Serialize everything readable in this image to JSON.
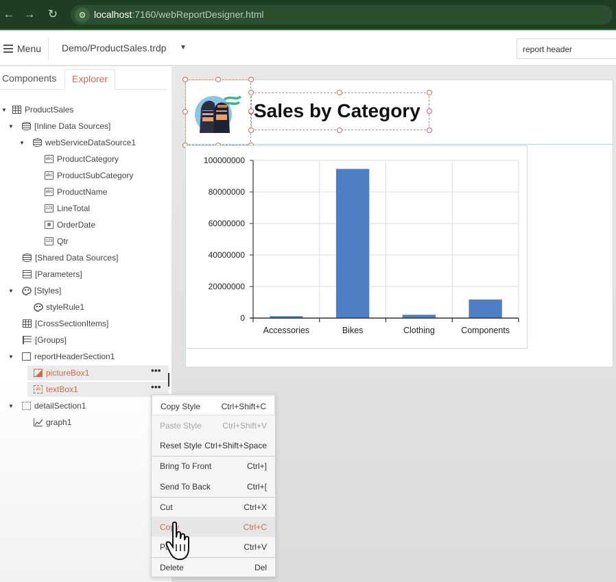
{
  "browser": {
    "url_host": "localhost",
    "url_rest": ":7160/webReportDesigner.html"
  },
  "toolbar": {
    "menu_label": "Menu",
    "document": "Demo/ProductSales.trdp",
    "search_value": "report header"
  },
  "tabs": {
    "components": "Components",
    "explorer": "Explorer"
  },
  "tree": [
    {
      "label": "ProductSales",
      "icon": "table-icon"
    },
    {
      "label": "[Inline Data Sources]",
      "icon": "database-icon"
    },
    {
      "label": "webServiceDataSource1",
      "icon": "web-database-icon"
    },
    {
      "label": "ProductCategory",
      "icon": "text-field-icon",
      "badge": "abc"
    },
    {
      "label": "ProductSubCategory",
      "icon": "text-field-icon",
      "badge": "abc"
    },
    {
      "label": "ProductName",
      "icon": "text-field-icon",
      "badge": "abc"
    },
    {
      "label": "LineTotal",
      "icon": "number-field-icon",
      "badge": "123"
    },
    {
      "label": "OrderDate",
      "icon": "date-field-icon",
      "badge": ""
    },
    {
      "label": "Qtr",
      "icon": "number-field-icon",
      "badge": "123"
    },
    {
      "label": "[Shared Data Sources]",
      "icon": "database-icon"
    },
    {
      "label": "[Parameters]",
      "icon": "parameters-icon"
    },
    {
      "label": "[Styles]",
      "icon": "palette-icon"
    },
    {
      "label": "styleRule1",
      "icon": "palette-icon"
    },
    {
      "label": "[CrossSectionItems]",
      "icon": "grid-icon"
    },
    {
      "label": "[Groups]",
      "icon": "groups-icon"
    },
    {
      "label": "reportHeaderSection1",
      "icon": "section-icon"
    },
    {
      "label": "pictureBox1",
      "icon": "picture-icon"
    },
    {
      "label": "textBox1",
      "icon": "textbox-icon",
      "badge": "ab"
    },
    {
      "label": "detailSection1",
      "icon": "detail-section-icon"
    },
    {
      "label": "graph1",
      "icon": "graph-icon"
    }
  ],
  "report": {
    "title": "Sales by Category"
  },
  "chart_data": {
    "type": "bar",
    "categories": [
      "Accessories",
      "Bikes",
      "Clothing",
      "Components"
    ],
    "values": [
      1200000,
      94600000,
      2100000,
      11800000
    ],
    "ylim": [
      0,
      100000000
    ],
    "yticks": [
      "100000000",
      "80000000",
      "60000000",
      "40000000",
      "20000000",
      "0"
    ],
    "tick_values": [
      100000000,
      80000000,
      60000000,
      40000000,
      20000000,
      0
    ],
    "bar_color": "#4e7ec4",
    "grid": true
  },
  "context_menu": [
    {
      "label": "Copy Style",
      "shortcut": "Ctrl+Shift+C",
      "state": "normal"
    },
    {
      "label": "Paste Style",
      "shortcut": "Ctrl+Shift+V",
      "state": "disabled"
    },
    {
      "label": "Reset Style",
      "shortcut": "Ctrl+Shift+Space",
      "state": "normal"
    },
    {
      "label": "Bring To Front",
      "shortcut": "Ctrl+]",
      "state": "normal"
    },
    {
      "label": "Send To Back",
      "shortcut": "Ctrl+[",
      "state": "normal"
    },
    {
      "label": "Cut",
      "shortcut": "Ctrl+X",
      "state": "normal"
    },
    {
      "label": "Copy",
      "shortcut": "Ctrl+C",
      "state": "hover"
    },
    {
      "label": "Paste",
      "shortcut": "Ctrl+V",
      "state": "normal"
    },
    {
      "label": "Delete",
      "shortcut": "Del",
      "state": "normal"
    }
  ],
  "colors": {
    "accent": "#cf6a4c",
    "browser_bar": "#1e3d22"
  }
}
